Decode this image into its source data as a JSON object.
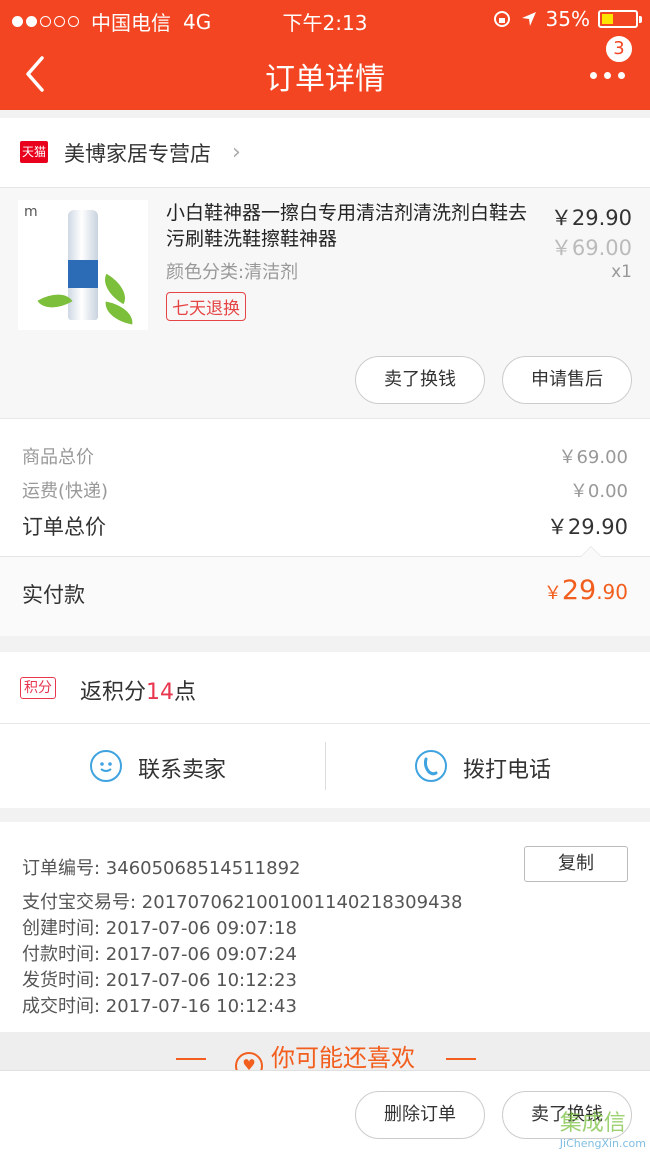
{
  "status_bar": {
    "carrier": "中国电信",
    "network": "4G",
    "time": "下午2:13",
    "battery": "35%",
    "battery_level": 0.35
  },
  "nav": {
    "title": "订单详情",
    "badge": "3"
  },
  "store": {
    "badge_text": "天猫",
    "name": "美博家居专营店"
  },
  "product": {
    "title": "小白鞋神器一擦白专用清洁剂清洗剂白鞋去污刷鞋洗鞋擦鞋神器",
    "variant": "颜色分类:清洁剂",
    "tag": "七天退换",
    "price": "￥29.90",
    "original_price": "￥69.00",
    "quantity": "x1",
    "image_brand": "m"
  },
  "product_actions": {
    "sell": "卖了换钱",
    "after_sale": "申请售后"
  },
  "totals": {
    "goods_label": "商品总价",
    "goods_value": "￥69.00",
    "shipping_label": "运费(快递)",
    "shipping_value": "￥0.00",
    "order_label": "订单总价",
    "order_value": "￥29.90",
    "paid_label": "实付款",
    "paid_symbol": "￥",
    "paid_int": "29",
    "paid_dec": ".90"
  },
  "points": {
    "tag": "积分",
    "prefix": "返积分",
    "number": "14",
    "suffix": "点"
  },
  "contact": {
    "seller": "联系卖家",
    "phone": "拨打电话"
  },
  "order_info": {
    "order_no": "订单编号:  346050685145118​92",
    "alipay_no": "支付宝交易号:  2017070621001001140218309438",
    "created": "创建时间:   2017-07-06 09:07:18",
    "paid": "付款时间:   2017-07-06 09:07:24",
    "shipped": "发货时间:   2017-07-06 10:12:23",
    "completed": "成交时间:   2017-07-16 10:12:43",
    "copy": "复制"
  },
  "recommend": {
    "title": "你可能还喜欢"
  },
  "bottom_actions": {
    "delete": "删除订单",
    "sell": "卖了换钱"
  },
  "watermark": {
    "text": "集成信",
    "url": "JiChengXin.com"
  },
  "colors": {
    "brand": "#f34521",
    "price_accent": "#f25e1d",
    "points_red": "#e8364f",
    "contact_blue": "#3fa3e0"
  }
}
